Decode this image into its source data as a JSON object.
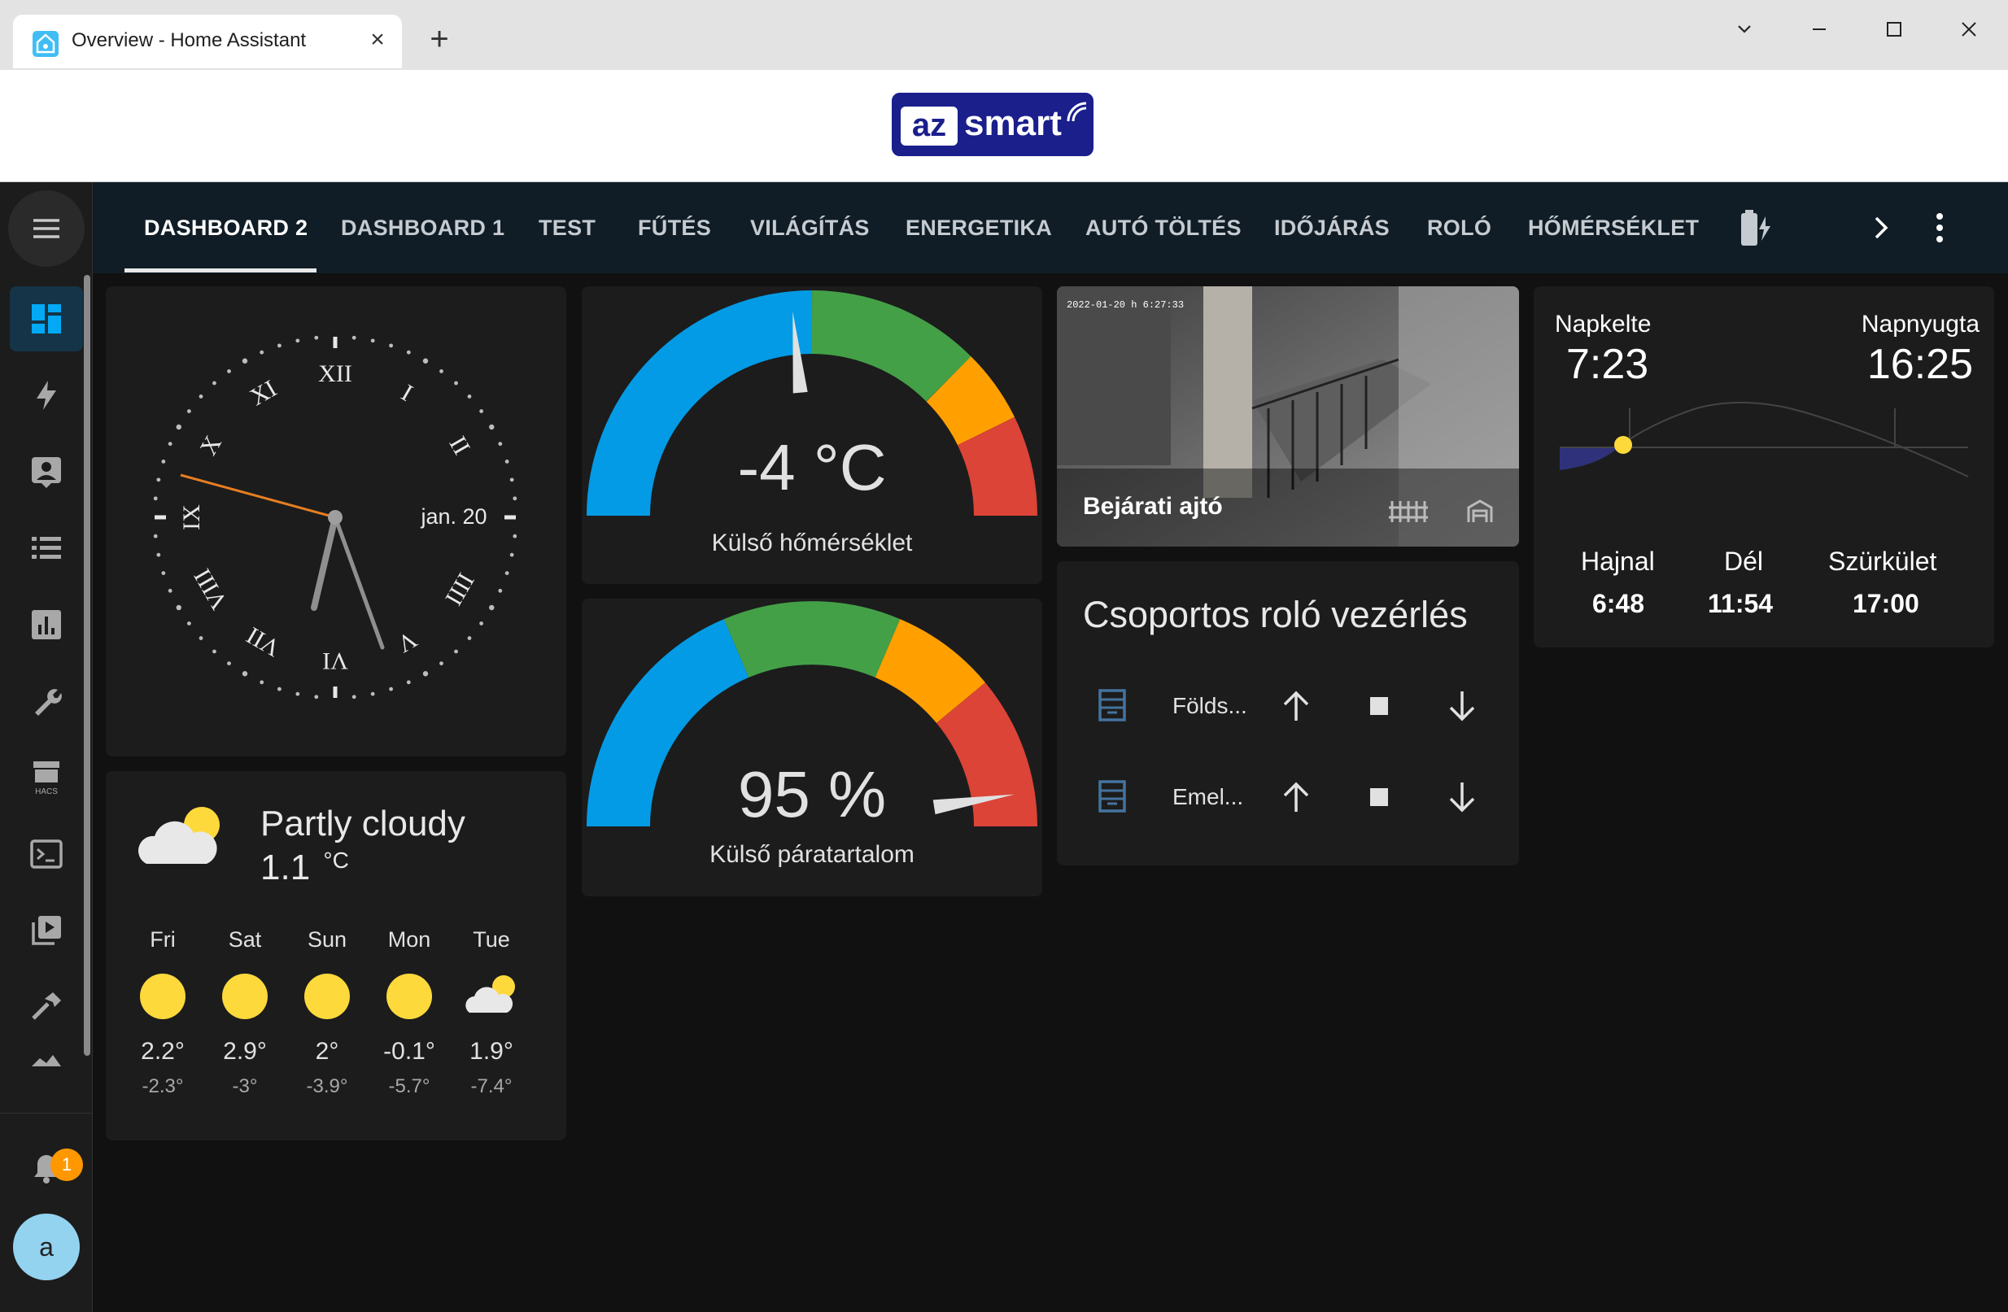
{
  "browser": {
    "tab_title": "Overview - Home Assistant",
    "close": "×",
    "new_tab": "+"
  },
  "logo": {
    "part1": "az",
    "part2": "smart"
  },
  "nav_tabs": [
    "DASHBOARD 2",
    "DASHBOARD 1",
    "TEST",
    "FŰTÉS",
    "VILÁGÍTÁS",
    "ENERGETIKA",
    "AUTÓ TÖLTÉS",
    "IDŐJÁRÁS",
    "ROLÓ",
    "HŐMÉRSÉKLET"
  ],
  "sidebar": {
    "notification_count": "1",
    "avatar_letter": "a",
    "hacs_label": "HACS"
  },
  "clock": {
    "numerals": [
      "XII",
      "I",
      "II",
      "III",
      "IIII",
      "V",
      "VI",
      "VII",
      "VIII",
      "IX",
      "X",
      "XI"
    ],
    "date": "jan. 20"
  },
  "gauge_temp": {
    "value": "-4 °C",
    "label": "Külső hőmérséklet",
    "level_percent": 47
  },
  "gauge_humidity": {
    "value": "95 %",
    "label": "Külső páratartalom",
    "level_percent": 95
  },
  "camera": {
    "timestamp": "2022-01-20 h 6:27:33",
    "name": "Bejárati ajtó"
  },
  "rollers": {
    "title": "Csoportos roló vezérlés",
    "items": [
      {
        "name": "Földs..."
      },
      {
        "name": "Emel..."
      }
    ]
  },
  "sun": {
    "sunrise_label": "Napkelte",
    "sunrise": "7:23",
    "sunset_label": "Napnyugta",
    "sunset": "16:25",
    "dawn_label": "Hajnal",
    "dawn": "6:48",
    "noon_label": "Dél",
    "noon": "11:54",
    "dusk_label": "Szürkület",
    "dusk": "17:00"
  },
  "weather": {
    "condition": "Partly cloudy",
    "temperature": "1.1",
    "unit": "°C",
    "forecast": [
      {
        "day": "Fri",
        "icon": "sun-icon",
        "high": "2.2°",
        "low": "-2.3°"
      },
      {
        "day": "Sat",
        "icon": "sun-icon",
        "high": "2.9°",
        "low": "-3°"
      },
      {
        "day": "Sun",
        "icon": "sun-icon",
        "high": "2°",
        "low": "-3.9°"
      },
      {
        "day": "Mon",
        "icon": "sun-icon",
        "high": "-0.1°",
        "low": "-5.7°"
      },
      {
        "day": "Tue",
        "icon": "partly-cloudy-icon",
        "high": "1.9°",
        "low": "-7.4°"
      }
    ]
  },
  "colors": {
    "accent": "#03a9f4",
    "gauge_blue": "#039be5",
    "gauge_green": "#43a047",
    "gauge_orange": "#ffa000",
    "gauge_red": "#db4437",
    "sun_yellow": "#fdd93c",
    "clock_second_hand": "#e67e22"
  }
}
